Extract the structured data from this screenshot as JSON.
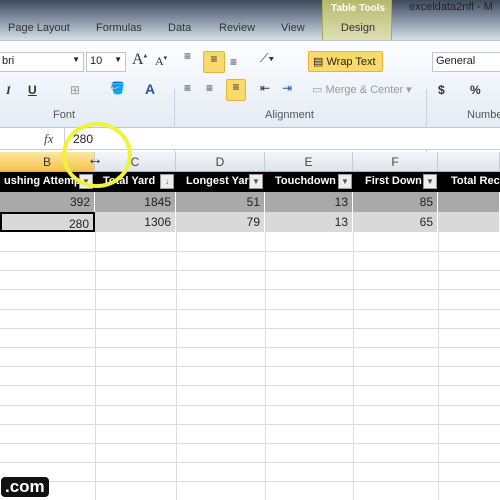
{
  "window": {
    "title": "exceldata2nfl  -  M"
  },
  "tabs": [
    "Page Layout",
    "Formulas",
    "Data",
    "Review",
    "View"
  ],
  "table_tools": {
    "label": "Table Tools",
    "tab": "Design"
  },
  "ribbon": {
    "font_name": "bri",
    "font_size": "10",
    "wrap_text": "Wrap Text",
    "merge_center": "Merge & Center",
    "number_format": "General",
    "groups": {
      "font": "Font",
      "alignment": "Alignment",
      "number": "Numbe"
    },
    "currency": "$",
    "percent": "%"
  },
  "formula_bar": {
    "fx": "fx",
    "value": "280"
  },
  "columns": [
    "B",
    "C",
    "D",
    "E",
    "F"
  ],
  "selected_column": "B",
  "table": {
    "headers": [
      "ushing Attemp",
      "Total Yard",
      "Longest Yar",
      "Touchdown",
      "First Down",
      "Total Rec"
    ],
    "rows": [
      [
        "392",
        "1845",
        "51",
        "13",
        "85",
        ""
      ],
      [
        "280",
        "1306",
        "79",
        "13",
        "65",
        ""
      ]
    ]
  },
  "watermark": ".com",
  "colors": {
    "selected_header": "#f6c34a",
    "table_header": "#000000",
    "row1": "#a9a9a9",
    "row2": "#d9d9d9",
    "highlight_circle": "#f1f23a"
  }
}
